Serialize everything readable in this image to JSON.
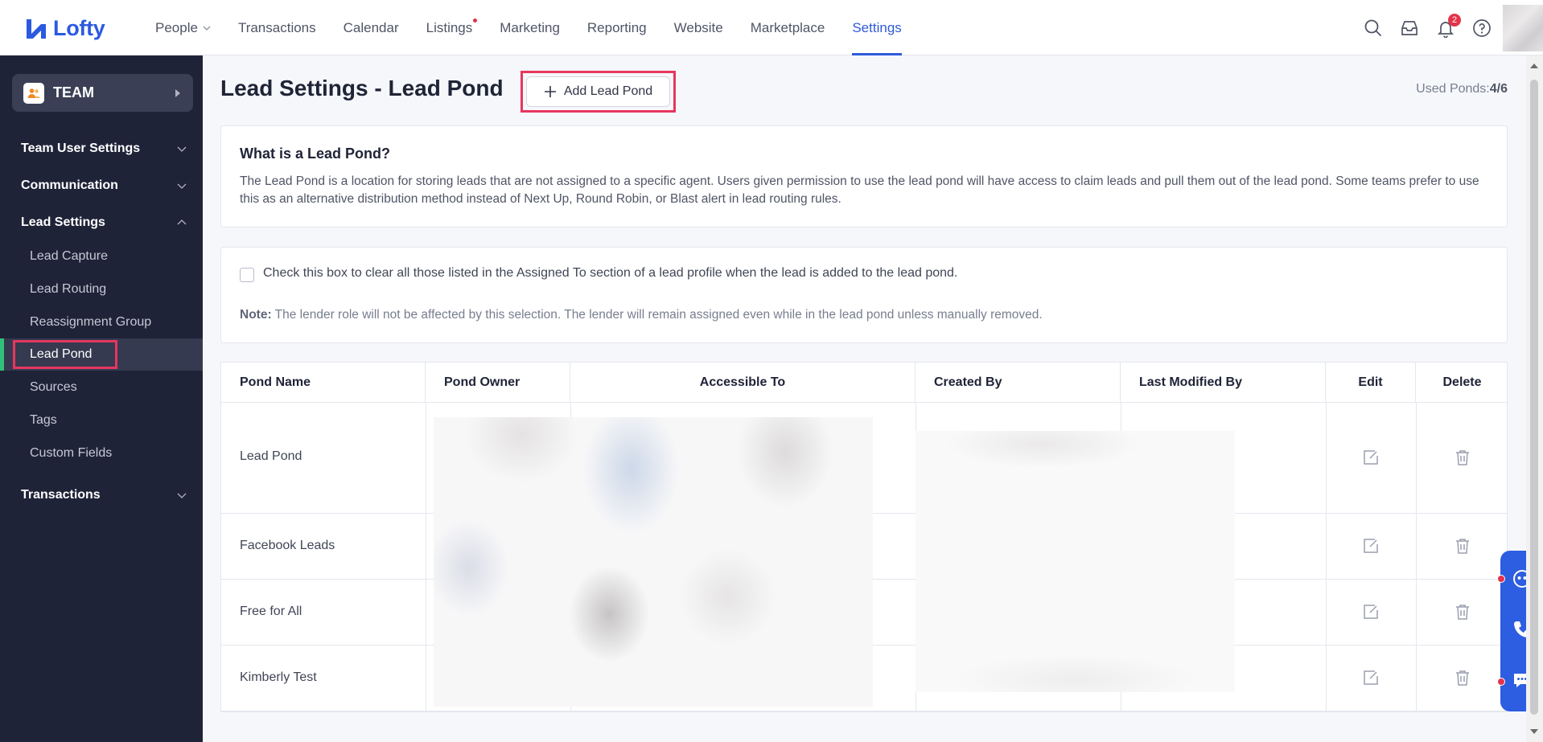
{
  "brand": {
    "name": "Lofty"
  },
  "nav": {
    "items": [
      {
        "label": "People"
      },
      {
        "label": "Transactions"
      },
      {
        "label": "Calendar"
      },
      {
        "label": "Listings"
      },
      {
        "label": "Marketing"
      },
      {
        "label": "Reporting"
      },
      {
        "label": "Website"
      },
      {
        "label": "Marketplace"
      },
      {
        "label": "Settings"
      }
    ],
    "active": "Settings",
    "notification_count": "2"
  },
  "sidebar": {
    "team_label": "TEAM",
    "sections": [
      {
        "label": "Team User Settings"
      },
      {
        "label": "Communication"
      },
      {
        "label": "Lead Settings"
      },
      {
        "label": "Transactions"
      }
    ],
    "lead_settings_items": [
      {
        "label": "Lead Capture"
      },
      {
        "label": "Lead Routing"
      },
      {
        "label": "Reassignment Group"
      },
      {
        "label": "Lead Pond"
      },
      {
        "label": "Sources"
      },
      {
        "label": "Tags"
      },
      {
        "label": "Custom Fields"
      }
    ],
    "active_item": "Lead Pond"
  },
  "page": {
    "title": "Lead Settings - Lead Pond",
    "add_button": "Add Lead Pond",
    "used_ponds_label": "Used Ponds:",
    "used_ponds_value": "4/6"
  },
  "info": {
    "title": "What is a Lead Pond?",
    "description": "The Lead Pond is a location for storing leads that are not assigned to a specific agent. Users given permission to use the lead pond will have access to claim leads and pull them out of the lead pond. Some teams prefer to use this as an alternative distribution method instead of Next Up, Round Robin, or Blast alert in lead routing rules."
  },
  "options": {
    "checkbox_label": "Check this box to clear all those listed in the Assigned To section of a lead profile when the lead is added to the lead pond.",
    "checkbox_checked": false,
    "note_label": "Note:",
    "note_text": "The lender role will not be affected by this selection. The lender will remain assigned even while in the lead pond unless manually removed."
  },
  "table": {
    "columns": [
      "Pond Name",
      "Pond Owner",
      "Accessible To",
      "Created By",
      "Last Modified By",
      "Edit",
      "Delete"
    ],
    "rows": [
      {
        "pond_name": "Lead Pond"
      },
      {
        "pond_name": "Facebook Leads"
      },
      {
        "pond_name": "Free for All"
      },
      {
        "pond_name": "Kimberly Test"
      }
    ]
  },
  "colors": {
    "accent": "#2f5ad9",
    "sidebar_bg": "#1f2338",
    "highlight": "#e8365d",
    "active_marker": "#30c27b"
  }
}
